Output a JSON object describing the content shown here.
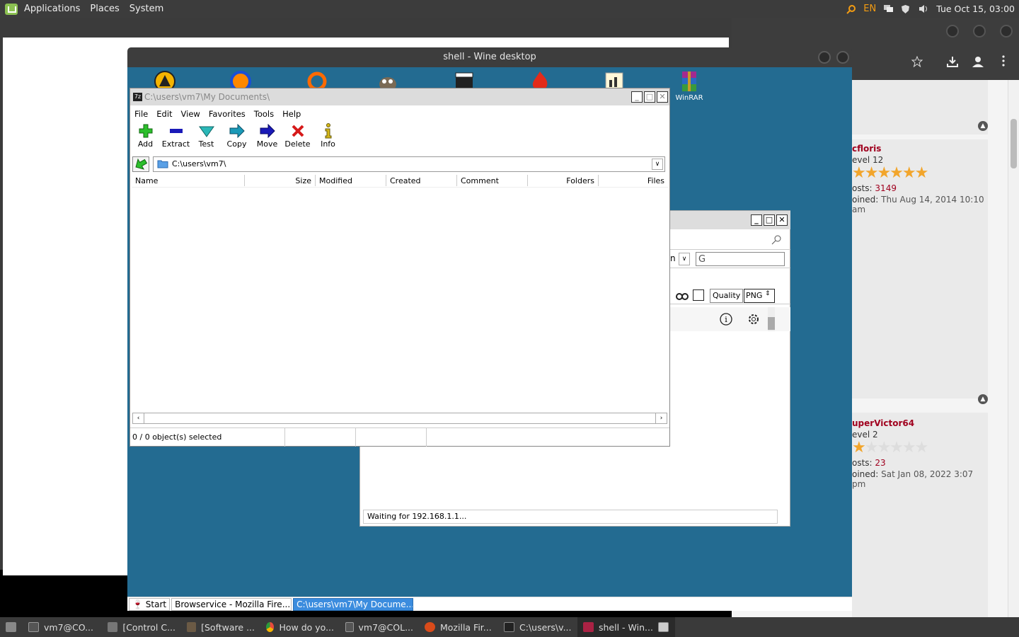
{
  "top_panel": {
    "menus": [
      "Applications",
      "Places",
      "System"
    ],
    "keyboard_layout": "EN",
    "clock": "Tue Oct 15, 03:00"
  },
  "wine_window": {
    "title": "shell - Wine desktop",
    "desktop_icons": [
      {
        "label": "",
        "icon": "vlc-icon"
      },
      {
        "label": "",
        "icon": "music-player-icon"
      },
      {
        "label": "",
        "icon": "orange-ring-icon"
      },
      {
        "label": "",
        "icon": "gimp-icon"
      },
      {
        "label": "",
        "icon": "clapperboard-icon"
      },
      {
        "label": "",
        "icon": "fire-icon"
      },
      {
        "label": "",
        "icon": "chart-icon"
      },
      {
        "label": "WinRAR",
        "icon": "winrar-icon"
      }
    ],
    "taskbar": {
      "start": "Start",
      "items": [
        "Browservice - Mozilla Fire...",
        "C:\\users\\vm7\\My Docume..."
      ]
    }
  },
  "sevenzip": {
    "title": "C:\\users\\vm7\\My Documents\\",
    "menu": [
      "File",
      "Edit",
      "View",
      "Favorites",
      "Tools",
      "Help"
    ],
    "toolbar": [
      "Add",
      "Extract",
      "Test",
      "Copy",
      "Move",
      "Delete",
      "Info"
    ],
    "address": "C:\\users\\vm7\\",
    "columns": [
      "Name",
      "Size",
      "Modified",
      "Created",
      "Comment",
      "Folders",
      "Files"
    ],
    "status": "0 / 0 object(s) selected"
  },
  "browservice_window": {
    "quality_label": "Quality",
    "format": "PNG",
    "status": "Waiting for 192.168.1.1...",
    "partial_select": "n"
  },
  "forum": {
    "posts": [
      {
        "user": "cfloris",
        "level": "evel 12",
        "stars_filled": 6,
        "stars_total": 6,
        "posts_label": "osts:",
        "posts": "3149",
        "joined_label": "oined:",
        "joined": "Thu Aug 14, 2014 10:10 am"
      },
      {
        "user": "uperVictor64",
        "level": "evel 2",
        "stars_filled": 1,
        "stars_total": 6,
        "posts_label": "osts:",
        "posts": "23",
        "joined_label": "oined:",
        "joined": "Sat Jan 08, 2022 3:07 pm"
      }
    ]
  },
  "bottom_taskbar": {
    "items": [
      {
        "label": "vm7@CO...",
        "color": "#555555"
      },
      {
        "label": "[Control C...",
        "color": "#777777"
      },
      {
        "label": "[Software ...",
        "color": "#6b5a45"
      },
      {
        "label": "How do yo...",
        "color": "#e84b3c"
      },
      {
        "label": "vm7@COL...",
        "color": "#555555"
      },
      {
        "label": "Mozilla Fir...",
        "color": "#d94b1a"
      },
      {
        "label": "C:\\users\\v...",
        "color": "#222222"
      },
      {
        "label": "shell - Win...",
        "color": "#aa2244"
      }
    ]
  },
  "colors": {
    "wine_desktop": "#236b91",
    "panel": "#3c3c3c",
    "forum_accent": "#a0001e"
  }
}
